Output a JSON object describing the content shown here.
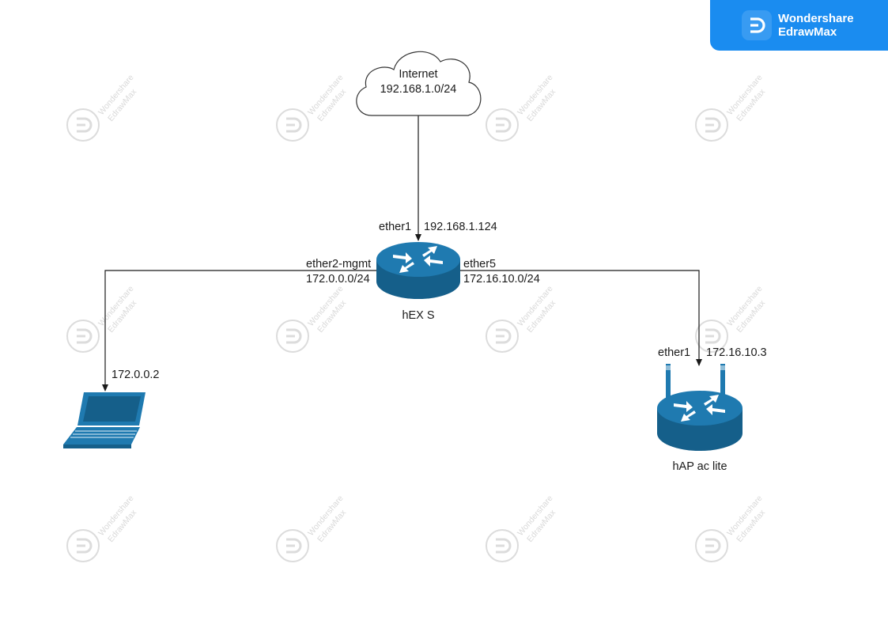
{
  "brand": {
    "name": "Wondershare\nEdrawMax",
    "color": "#1a8cf0"
  },
  "watermark": {
    "line1": "Wondershare",
    "line2": "EdrawMax"
  },
  "colors": {
    "device_fill": "#1f7ab0",
    "device_dark": "#155f8a",
    "line": "#1a1a1a"
  },
  "nodes": {
    "internet": {
      "line1": "Internet",
      "line2": "192.168.1.0/24"
    },
    "router": {
      "label": "hEX S"
    },
    "access_point": {
      "label": "hAP ac lite"
    }
  },
  "links": {
    "uplink": {
      "port": "ether1",
      "ip": "192.168.1.124"
    },
    "mgmt": {
      "port": "ether2-mgmt",
      "subnet": "172.0.0.0/24"
    },
    "lan": {
      "port": "ether5",
      "subnet": "172.16.10.0/24"
    },
    "laptop_ip": "172.0.0.2",
    "ap_uplink": {
      "port": "ether1",
      "ip": "172.16.10.3"
    }
  }
}
